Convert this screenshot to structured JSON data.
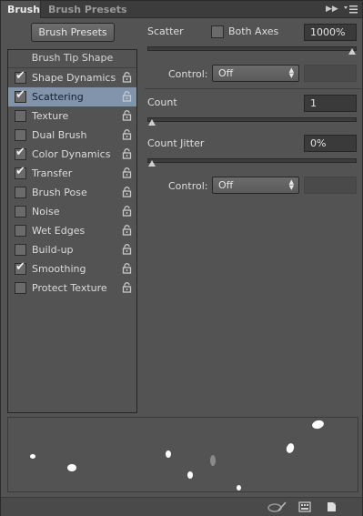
{
  "tabs": {
    "active": "Brush",
    "inactive": "Brush Presets"
  },
  "left": {
    "presets_button": "Brush Presets",
    "tip_shape": "Brush Tip Shape",
    "items": [
      {
        "label": "Shape Dynamics",
        "checked": true
      },
      {
        "label": "Scattering",
        "checked": true
      },
      {
        "label": "Texture",
        "checked": false
      },
      {
        "label": "Dual Brush",
        "checked": false
      },
      {
        "label": "Color Dynamics",
        "checked": true
      },
      {
        "label": "Transfer",
        "checked": true
      },
      {
        "label": "Brush Pose",
        "checked": false
      },
      {
        "label": "Noise",
        "checked": false
      },
      {
        "label": "Wet Edges",
        "checked": false
      },
      {
        "label": "Build-up",
        "checked": false
      },
      {
        "label": "Smoothing",
        "checked": true
      },
      {
        "label": "Protect Texture",
        "checked": false
      }
    ]
  },
  "scatter": {
    "label": "Scatter",
    "both_axes": "Both Axes",
    "both_axes_checked": false,
    "value": "1000%",
    "level": 1.0,
    "control_label": "Control:",
    "control_value": "Off",
    "jitter_field": ""
  },
  "count": {
    "label": "Count",
    "value": "1",
    "level": 0.0
  },
  "count_jitter": {
    "label": "Count Jitter",
    "value": "0%",
    "level": 0.0,
    "control_label": "Control:",
    "control_value": "Off",
    "jitter_field": ""
  },
  "colors": {
    "selected_row": "#8293ac",
    "panel": "#535353",
    "field": "#3a3a3a"
  },
  "icons": {
    "lock": "lock-icon",
    "menu": "panel-menu-icon",
    "collapse": "collapse-arrows-icon"
  }
}
